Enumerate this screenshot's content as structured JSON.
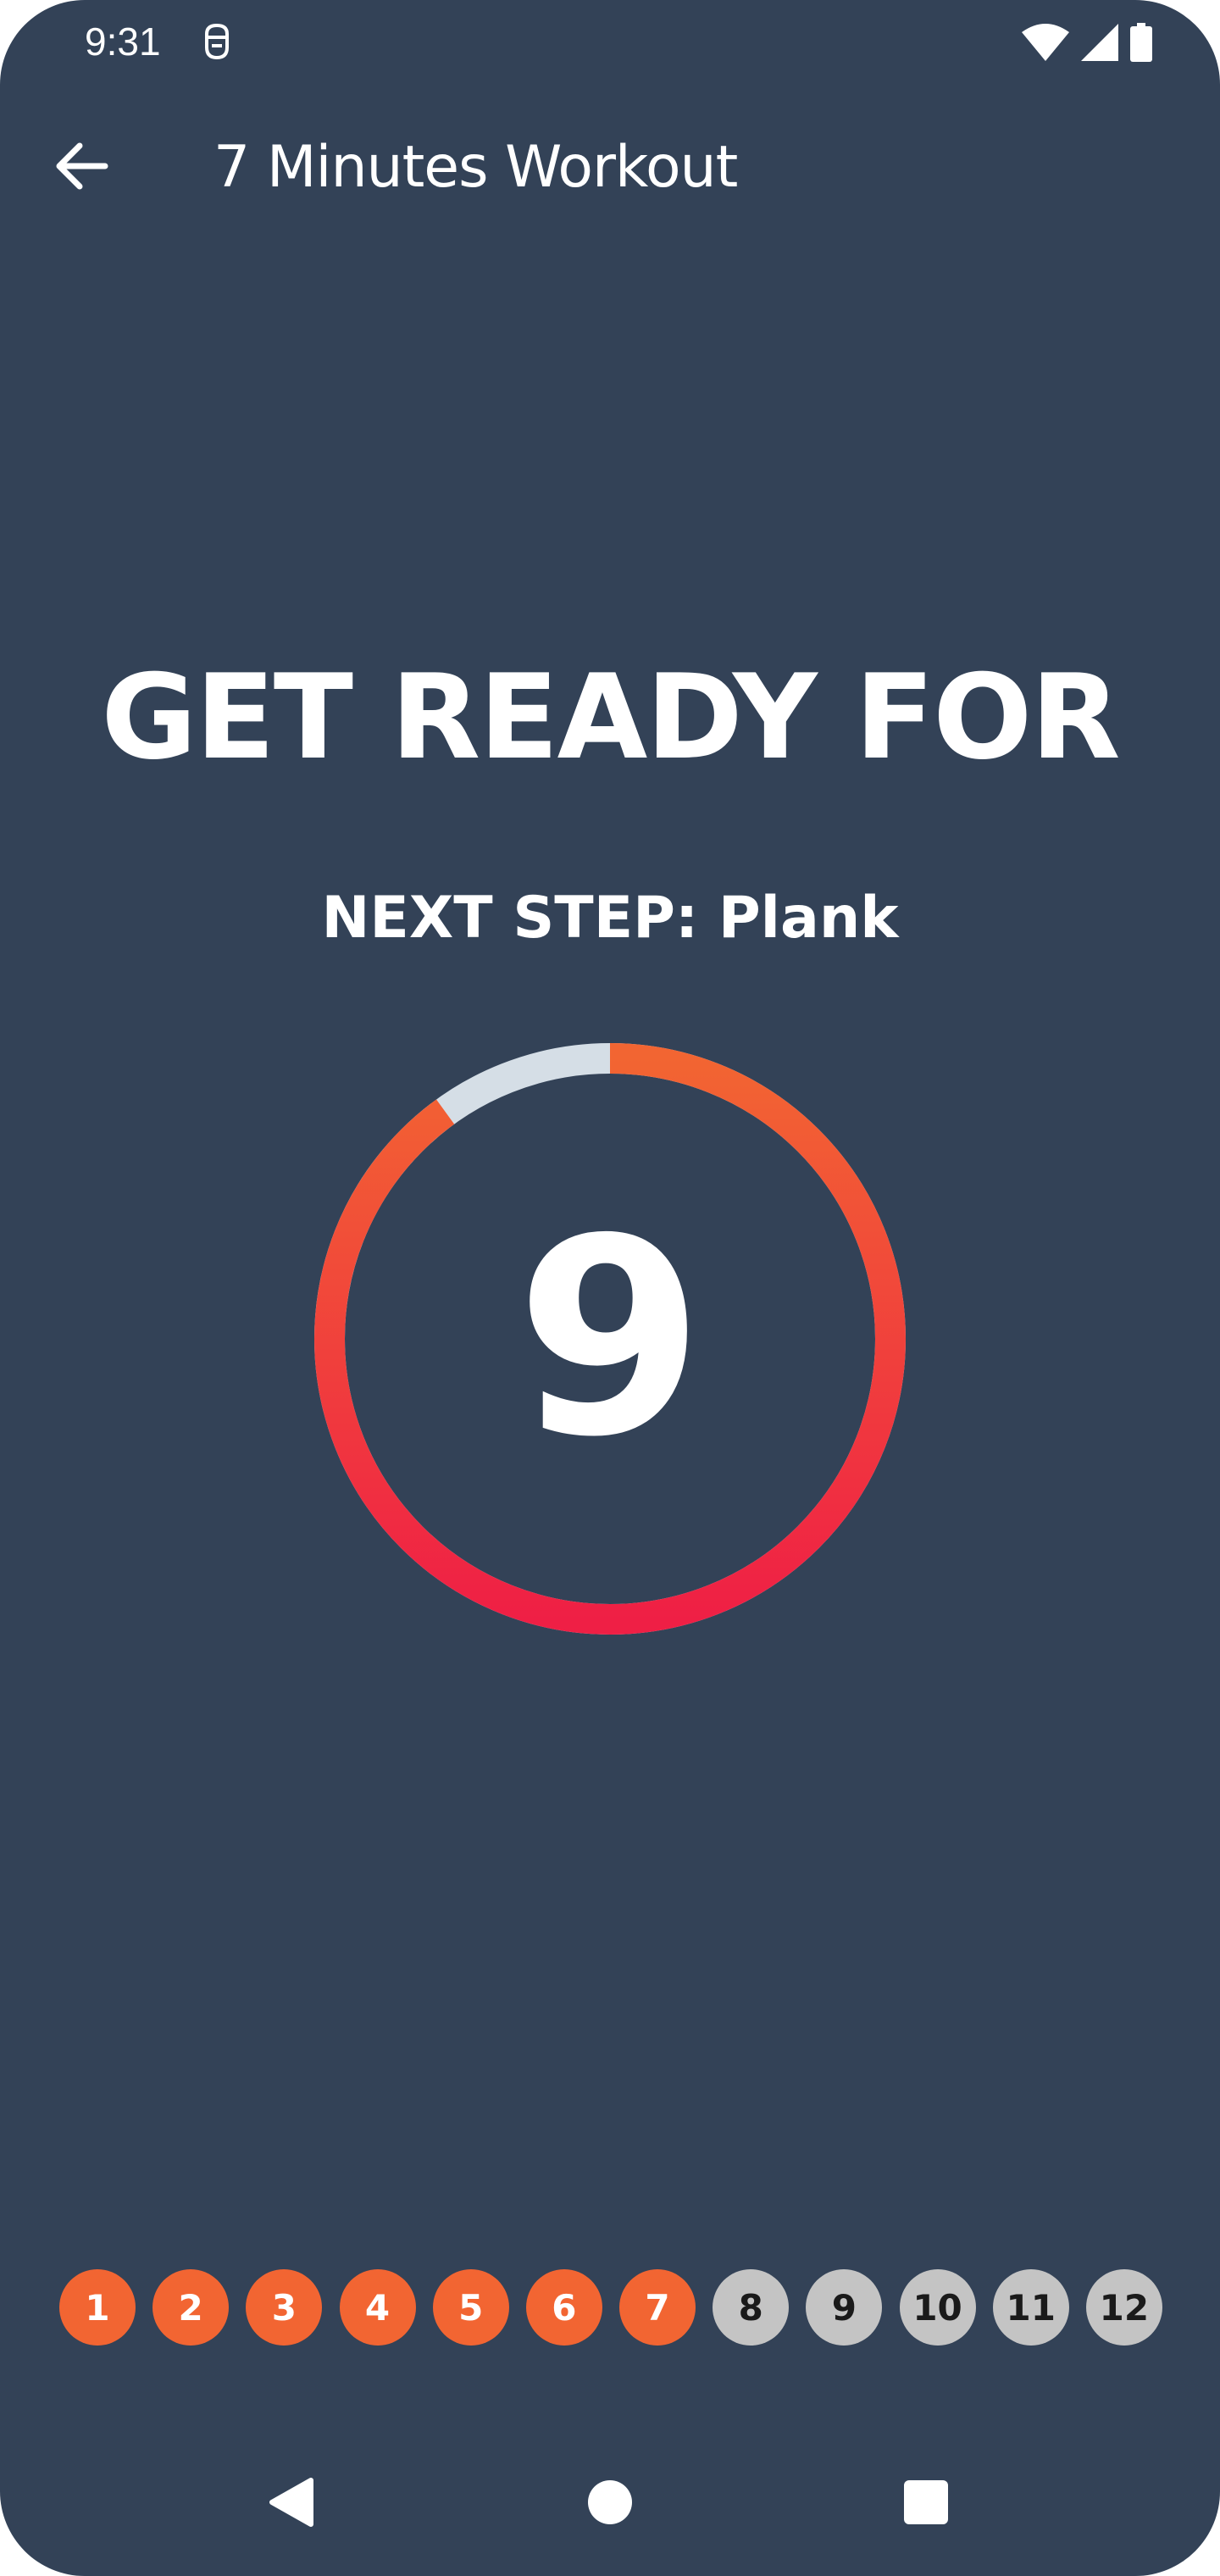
{
  "status_bar": {
    "time": "9:31",
    "icons": [
      "app-notification-icon",
      "wifi-icon",
      "cellular-signal-icon",
      "battery-icon"
    ]
  },
  "app_bar": {
    "back_icon": "arrow-left-icon",
    "title": "7 Minutes Workout"
  },
  "main": {
    "headline": "GET READY FOR",
    "next_step": "NEXT STEP: Plank",
    "timer": {
      "value": "9",
      "progress": 0.9
    }
  },
  "steps": [
    {
      "label": "1",
      "status": "done"
    },
    {
      "label": "2",
      "status": "done"
    },
    {
      "label": "3",
      "status": "done"
    },
    {
      "label": "4",
      "status": "done"
    },
    {
      "label": "5",
      "status": "done"
    },
    {
      "label": "6",
      "status": "done"
    },
    {
      "label": "7",
      "status": "done"
    },
    {
      "label": "8",
      "status": "todo"
    },
    {
      "label": "9",
      "status": "todo"
    },
    {
      "label": "10",
      "status": "todo"
    },
    {
      "label": "11",
      "status": "todo"
    },
    {
      "label": "12",
      "status": "todo"
    }
  ],
  "nav_bar": {
    "icons": [
      "back-triangle-icon",
      "home-circle-icon",
      "recents-square-icon"
    ]
  },
  "colors": {
    "background": "#334257",
    "accent": "#f26532",
    "ring_start": "#ef1f45",
    "ring_end": "#f26532",
    "ring_track": "#d5dee6",
    "step_done": "#f26532",
    "step_todo": "#c4c4c4"
  }
}
